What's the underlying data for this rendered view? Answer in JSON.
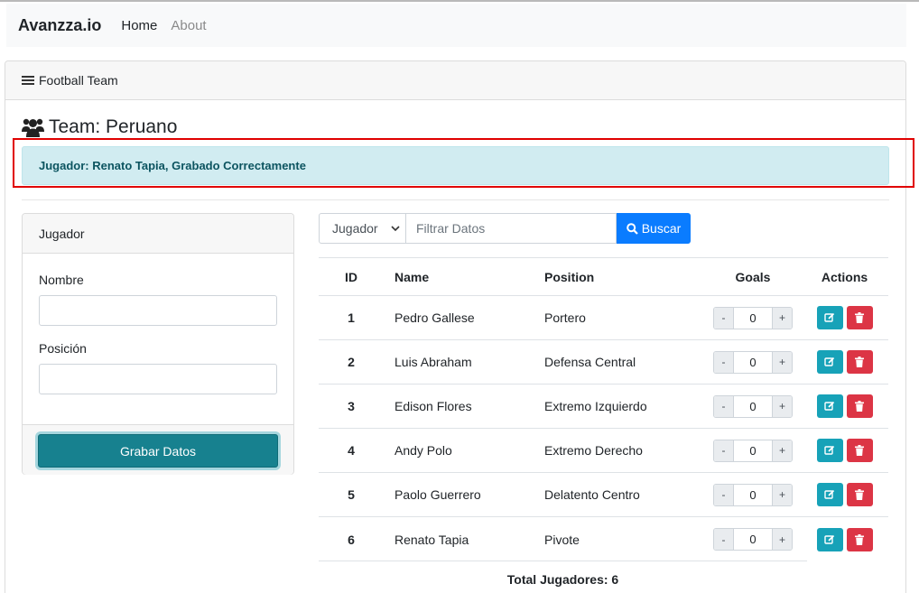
{
  "navbar": {
    "brand": "Avanzza.io",
    "links": [
      "Home",
      "About"
    ]
  },
  "card": {
    "header": "Football Team",
    "header_icon": "list-icon"
  },
  "team": {
    "title": "Team: Peruano",
    "icon": "users-icon"
  },
  "alert": {
    "message": "Jugador: Renato Tapia, Grabado Correctamente"
  },
  "form": {
    "header": "Jugador",
    "name_label": "Nombre",
    "name_value": "",
    "position_label": "Posición",
    "position_value": "",
    "submit_label": "Grabar Datos"
  },
  "search": {
    "select_value": "Jugador",
    "placeholder": "Filtrar Datos",
    "button_label": "Buscar"
  },
  "table": {
    "columns": [
      "ID",
      "Name",
      "Position",
      "Goals",
      "Actions"
    ],
    "rows": [
      {
        "id": "1",
        "name": "Pedro Gallese",
        "position": "Portero",
        "goals": "0"
      },
      {
        "id": "2",
        "name": "Luis Abraham",
        "position": "Defensa Central",
        "goals": "0"
      },
      {
        "id": "3",
        "name": "Edison Flores",
        "position": "Extremo Izquierdo",
        "goals": "0"
      },
      {
        "id": "4",
        "name": "Andy Polo",
        "position": "Extremo Derecho",
        "goals": "0"
      },
      {
        "id": "5",
        "name": "Paolo Guerrero",
        "position": "Delatento Centro",
        "goals": "0"
      },
      {
        "id": "6",
        "name": "Renato Tapia",
        "position": "Pivote",
        "goals": "0"
      }
    ],
    "stepper_minus": "-",
    "stepper_plus": "+"
  },
  "total": "Total Jugadores: 6",
  "colors": {
    "alert_bg": "#d1ecf1",
    "primary": "#0a7cff",
    "teal": "#17818f",
    "edit": "#17a2b8",
    "delete": "#dc3545",
    "highlight": "#e00000"
  }
}
